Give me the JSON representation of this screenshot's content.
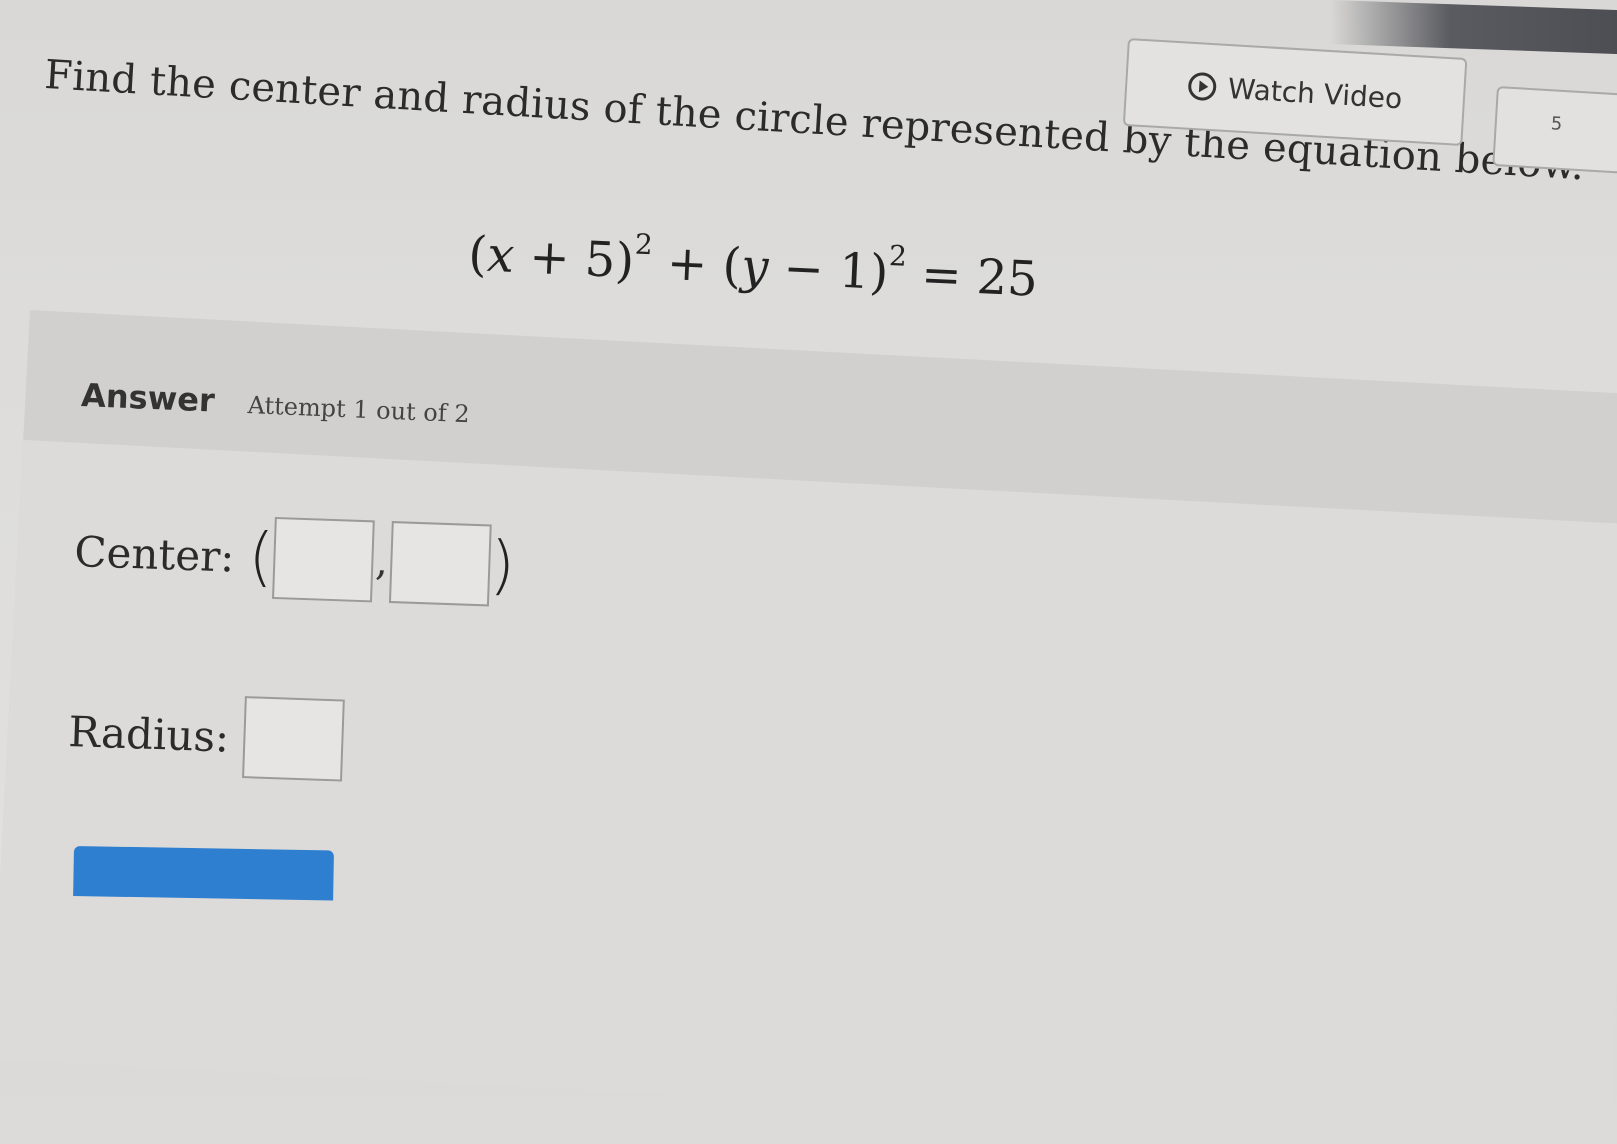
{
  "question": {
    "prompt": "Find the center and radius of the circle represented by the equation below.",
    "equation": {
      "open1": "(",
      "x": "x",
      "plus": " + 5)",
      "exp1": "2",
      "middle": " + (",
      "y": "y",
      "minus": " − 1)",
      "exp2": "2",
      "rhs": " = 25"
    }
  },
  "toolbar": {
    "watch_video_label": "Watch Video",
    "side_button_label": "5"
  },
  "answer": {
    "label": "Answer",
    "attempt_text": "Attempt 1 out of 2",
    "center": {
      "label": "Center:",
      "open_paren": "(",
      "comma": ",",
      "close_paren": ")",
      "x_value": "",
      "y_value": ""
    },
    "radius": {
      "label": "Radius:",
      "value": ""
    },
    "submit_label": ""
  },
  "colors": {
    "submit_blue": "#2f7fd0",
    "background": "#dddcda"
  },
  "icons": {
    "watch_video": "play-circle-icon"
  }
}
